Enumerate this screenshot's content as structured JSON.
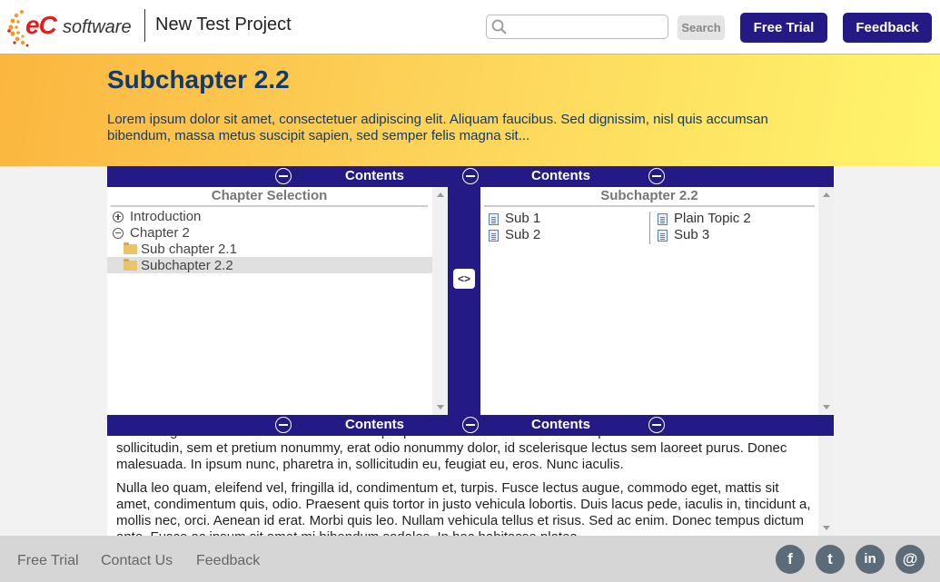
{
  "header": {
    "logo_ec": "eC",
    "logo_software": "software",
    "project_title": "New Test Project",
    "search_placeholder": "",
    "search_button": "Search",
    "free_trial_button": "Free Trial",
    "feedback_button": "Feedback"
  },
  "hero": {
    "title": "Subchapter 2.2",
    "text": "Lorem ipsum dolor sit amet, consectetuer adipiscing elit. Aliquam faucibus. Sed dignissim, nisl quis accumsan bibendum, massa metus suscipit sapien, sed semper felis magna sit..."
  },
  "toc_bar": {
    "left_label": "Contents",
    "right_label": "Contents",
    "toggle_label": "<>"
  },
  "left_panel": {
    "heading": "Chapter Selection",
    "items": [
      {
        "label": "Introduction"
      },
      {
        "label": "Chapter 2"
      },
      {
        "label": "Sub chapter 2.1"
      },
      {
        "label": "Subchapter 2.2"
      }
    ]
  },
  "right_panel": {
    "heading": "Subchapter 2.2",
    "col1": [
      {
        "label": "Sub 1"
      },
      {
        "label": "Sub 2"
      }
    ],
    "col2": [
      {
        "label": "Plain Topic 2"
      },
      {
        "label": "Sub 3"
      }
    ]
  },
  "content": {
    "p1": "Nullam egestas leo sit amet odio. Pellentesque placerat rutrum odio. Donec tempus dictum ante. Curabitur sollicitudin, sem et pretium nonummy, erat odio nonummy dolor, id scelerisque lectus sem laoreet purus. Donec malesuada. In ipsum nunc, pharetra in, sollicitudin eu, feugiat eu, eros. Nunc iaculis.",
    "p2": "Nulla leo quam, eleifend vel, fringilla id, condimentum et, turpis. Fusce lectus augue, commodo eget, mattis sit amet, condimentum quis, odio. Praesent quis tortor in justo vehicula lobortis. Duis lacus pede, iaculis in, tincidunt a, mollis nec, orci. Aenean id erat. Morbi quis leo. Nullam vehicula tellus et risus. Sed ac enim. Donec tempus dictum ante. Fusce ac ipsum sit amet mi bibendum sodales. In hac habitasse platea."
  },
  "footer": {
    "links": [
      "Free Trial",
      "Contact Us",
      "Feedback"
    ],
    "social": [
      "f",
      "t",
      "in",
      "@"
    ]
  },
  "colors": {
    "primary": "#231a86",
    "hero_start": "#fbb63f",
    "hero_end": "#fff56c",
    "title": "#123a6b"
  },
  "icons": [
    "search-icon",
    "collapse-icon",
    "expand-icon",
    "folder-icon",
    "document-icon",
    "facebook-icon",
    "twitter-icon",
    "linkedin-icon",
    "email-icon"
  ]
}
